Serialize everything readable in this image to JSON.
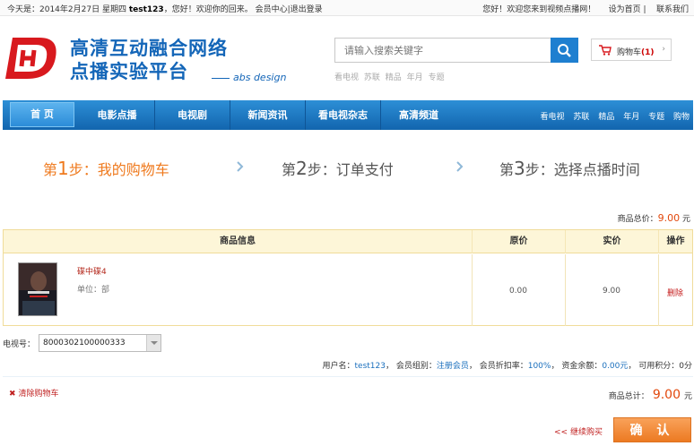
{
  "topbar": {
    "date": "今天是：2014年2月27日 星期四",
    "user": "test123",
    "greeting": "，您好！欢迎你的回来。",
    "member_center": "会员中心",
    "divider": "|",
    "logout": "退出登录",
    "welcome": "您好！欢迎您来到视频点播网！",
    "set_home": "设为首页",
    "sep": "|",
    "contact": "联系我们"
  },
  "header": {
    "brand_line1": "高清互动融合网络",
    "brand_line2": "点播实验平台",
    "brand_sub": "abs design",
    "search_placeholder": "请输入搜索关键字",
    "hotwords": [
      "看电视",
      "苏联",
      "精品",
      "年月",
      "专题"
    ],
    "cart_label": "购物车",
    "cart_count": "(1)",
    "cart_arrow": "›"
  },
  "nav": {
    "items": [
      "首 页",
      "电影点播",
      "电视剧",
      "新闻资讯",
      "看电视杂志",
      "高清频道"
    ],
    "links": [
      "看电视",
      "苏联",
      "精品",
      "年月",
      "专题",
      "购物"
    ]
  },
  "steps": [
    {
      "prefix": "第",
      "num": "1",
      "label": "步：我的购物车"
    },
    {
      "prefix": "第",
      "num": "2",
      "label": "步：订单支付"
    },
    {
      "prefix": "第",
      "num": "3",
      "label": "步：选择点播时间"
    }
  ],
  "summary_top": {
    "label": "商品总价：",
    "value": "9.00",
    "unit": "元"
  },
  "table": {
    "headers": [
      "商品信息",
      "原价",
      "实价",
      "操作"
    ],
    "rows": [
      {
        "name": "碟中碟4",
        "unit": "单位：部",
        "orig": "0.00",
        "actual": "9.00",
        "action": "删除"
      }
    ]
  },
  "tv": {
    "label": "电视号：",
    "value": "8000302100000333"
  },
  "userinfo": {
    "username_label": "用户名：",
    "username": "test123",
    "group_label": "，   会员组别：",
    "group": "注册会员",
    "discount_label": "，   会员折扣率：",
    "discount": "100%",
    "balance_label": "，   资金余额：",
    "balance": "0.00元",
    "points_label": "，   可用积分：",
    "points": "0分"
  },
  "footer": {
    "clear_icon": "✖",
    "clear_cart": "清除购物车",
    "total_label": "商品总计：",
    "total_value": "9.00",
    "total_unit": "元",
    "continue": "<< 继续购买",
    "confirm": "确 认"
  },
  "colors": {
    "accent": "#1466b8",
    "orange": "#ef7a1e",
    "price": "#e2480d"
  }
}
